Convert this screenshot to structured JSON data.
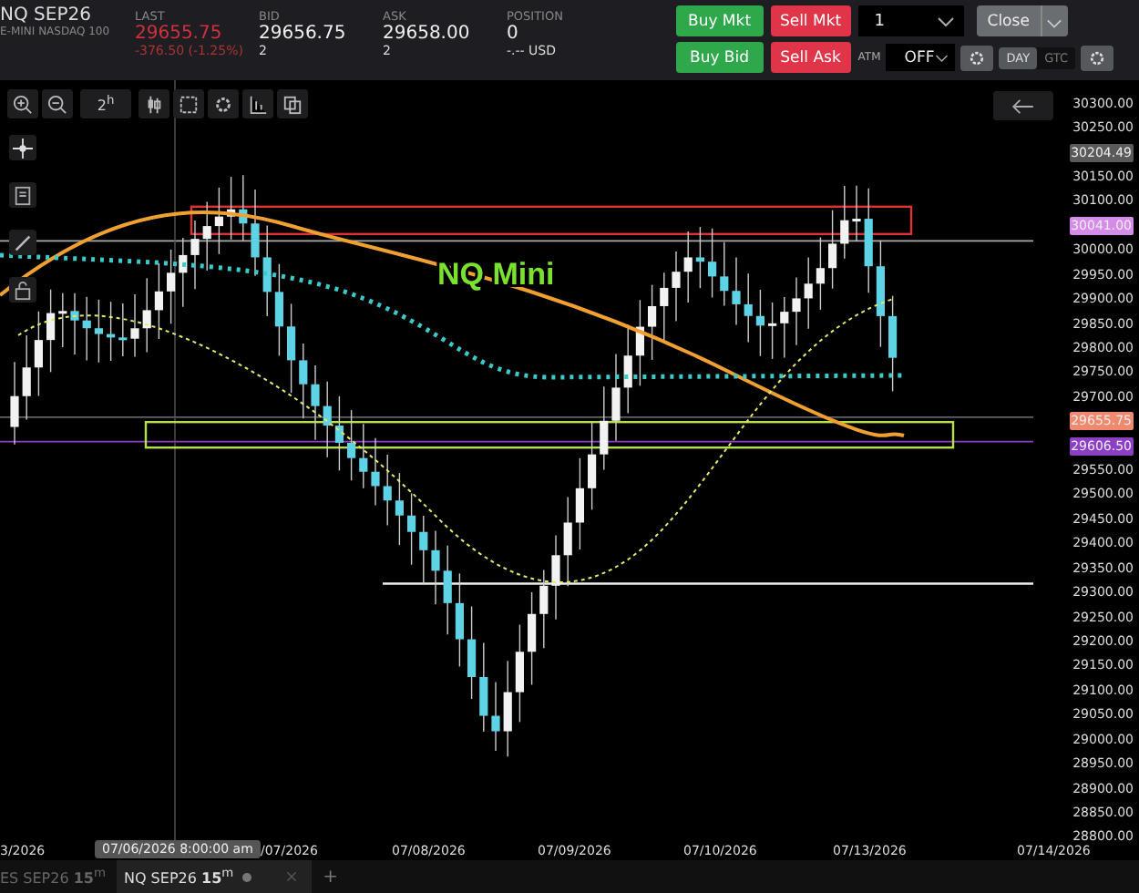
{
  "instrument": {
    "symbol": "NQ SEP26",
    "name": "E-MINI NASDAQ 100"
  },
  "quotes": [
    {
      "label": "LAST",
      "value": "29655.75",
      "sub": "-376.50 (-1.25%)",
      "kind": "down"
    },
    {
      "label": "BID",
      "value": "29656.75",
      "sub": "2",
      "kind": "plain"
    },
    {
      "label": "ASK",
      "value": "29658.00",
      "sub": "2",
      "kind": "plain"
    },
    {
      "label": "POSITION",
      "value": "0",
      "sub": "-.-- USD",
      "kind": "plain"
    }
  ],
  "order_buttons": [
    {
      "label": "Buy Mkt",
      "kind": "buy"
    },
    {
      "label": "Sell Mkt",
      "kind": "sell"
    },
    {
      "label": "Buy Bid",
      "kind": "buy"
    },
    {
      "label": "Sell Ask",
      "kind": "sell"
    }
  ],
  "quantity": "1",
  "close_button": "Close",
  "atm": {
    "label": "ATM",
    "value": "OFF"
  },
  "time_in_force": [
    {
      "label": "DAY",
      "selected": true
    },
    {
      "label": "GTC",
      "selected": false
    }
  ],
  "toolbar": {
    "interval": "2$^{h}$"
  },
  "chart": {
    "title": "NQ Mini",
    "price_axis": [
      {
        "label": "30300.00",
        "kind": "tick"
      },
      {
        "label": "30250.00",
        "kind": "tick"
      },
      {
        "label": "30204.49",
        "kind": "marker",
        "color": "#5a5a5a"
      },
      {
        "label": "30150.00",
        "kind": "tick"
      },
      {
        "label": "30100.00",
        "kind": "tick"
      },
      {
        "label": "30041.00",
        "kind": "marker",
        "color": "#d58be8"
      },
      {
        "label": "30000.00",
        "kind": "tick"
      },
      {
        "label": "29950.00",
        "kind": "tick"
      },
      {
        "label": "29900.00",
        "kind": "tick"
      },
      {
        "label": "29850.00",
        "kind": "tick"
      },
      {
        "label": "29800.00",
        "kind": "tick"
      },
      {
        "label": "29750.00",
        "kind": "tick"
      },
      {
        "label": "29700.00",
        "kind": "tick"
      },
      {
        "label": "29655.75",
        "kind": "marker",
        "color": "#f08a6e"
      },
      {
        "label": "29606.50",
        "kind": "marker",
        "color": "#8a3fc4"
      },
      {
        "label": "29550.00",
        "kind": "tick"
      },
      {
        "label": "29500.00",
        "kind": "tick"
      },
      {
        "label": "29450.00",
        "kind": "tick"
      },
      {
        "label": "29400.00",
        "kind": "tick"
      },
      {
        "label": "29350.00",
        "kind": "tick"
      },
      {
        "label": "29300.00",
        "kind": "tick"
      },
      {
        "label": "29250.00",
        "kind": "tick"
      },
      {
        "label": "29200.00",
        "kind": "tick"
      },
      {
        "label": "29150.00",
        "kind": "tick"
      },
      {
        "label": "29100.00",
        "kind": "tick"
      },
      {
        "label": "29050.00",
        "kind": "tick"
      },
      {
        "label": "29000.00",
        "kind": "tick"
      },
      {
        "label": "28950.00",
        "kind": "tick"
      },
      {
        "label": "28900.00",
        "kind": "tick"
      },
      {
        "label": "28850.00",
        "kind": "tick"
      },
      {
        "label": "28800.00",
        "kind": "tick"
      }
    ],
    "date_labels": [
      "3/2026",
      "/07/2026",
      "07/08/2026",
      "07/09/2026",
      "07/10/2026",
      "07/13/2026",
      "07/14/2026"
    ],
    "crosshair_label": "07/06/2026 8:00:00 am"
  },
  "add_tab": "+",
  "tabs": [
    {
      "label": "ES SEP26 **15**$^{m}$",
      "selected": false
    },
    {
      "label": "NQ SEP26 **15**$^{m}$",
      "selected": true
    }
  ]
}
